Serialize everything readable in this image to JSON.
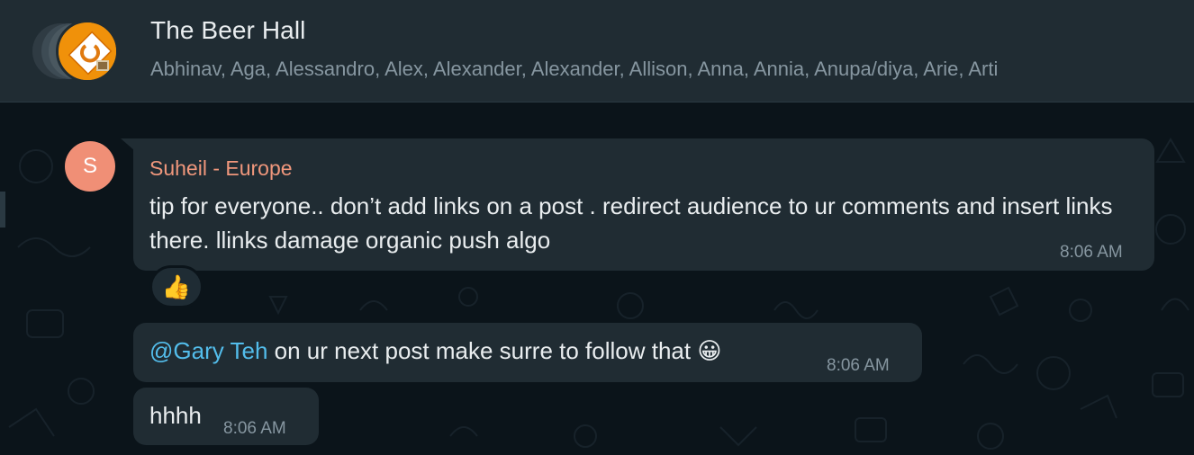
{
  "header": {
    "title": "The Beer Hall",
    "members": "Abhinav, Aga, Alessandro, Alex, Alexander, Alexander, Allison, Anna, Annia, Anupa/diya, Arie, Arti"
  },
  "messages": [
    {
      "sender": "Suheil - Europe",
      "sender_initial": "S",
      "text": "tip for everyone..  don’t add links on a post . redirect audience to ur comments and insert links there. llinks damage organic push algo",
      "time": "8:06 AM",
      "reaction": "👍"
    },
    {
      "mention": "@Gary Teh",
      "text": " on ur next post make surre to follow that 😀",
      "time": "8:06 AM"
    },
    {
      "text": "hhhh",
      "time": "8:06 AM"
    }
  ],
  "colors": {
    "header_bg": "#202c33",
    "chat_bg": "#0b141a",
    "bubble_bg": "#202c33",
    "sender_name": "#f0977c",
    "mention": "#53bdeb",
    "group_avatar": "#f0910a"
  }
}
